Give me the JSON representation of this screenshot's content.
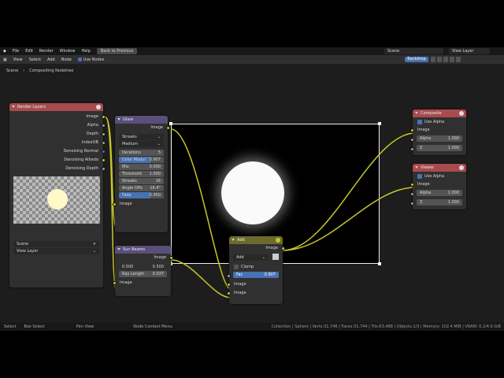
{
  "menubar": {
    "items": [
      "File",
      "Edit",
      "Render",
      "Window",
      "Help"
    ],
    "back_button": "Back to Previous",
    "scene": "Scene",
    "view_layer": "View Layer"
  },
  "header": {
    "items": [
      "View",
      "Select",
      "Add",
      "Node"
    ],
    "use_nodes": "Use Nodes",
    "backdrop": "Backdrop"
  },
  "breadcrumb": [
    "Scene",
    "Compositing Nodetree"
  ],
  "nodes": {
    "render_layers": {
      "title": "Render Layers",
      "outputs": [
        "Image",
        "Alpha",
        "Depth",
        "IndexOB",
        "Denoising Normal",
        "Denoising Albedo",
        "Denoising Depth"
      ],
      "scene": "Scene",
      "view_layer": "View Layer"
    },
    "glare": {
      "title": "Glare",
      "output": "Image",
      "type": "Streaks",
      "quality": "Medium",
      "iterations_label": "Iterations",
      "iterations": "5",
      "color_mod_label": "Color Modul",
      "color_mod": "0.907",
      "mix_label": "Mix",
      "mix": "0.000",
      "threshold_label": "Threshold",
      "threshold": "1.000",
      "streaks_label": "Streaks",
      "streaks": "16",
      "angle_label": "Angle Offs",
      "angle": "16.4°",
      "fade_label": "Fade",
      "fade": "0.950",
      "input": "Image"
    },
    "sun_beams": {
      "title": "Sun Beams",
      "output": "Image",
      "source_x": "0.500",
      "source_y": "0.500",
      "ray_length_label": "Ray Length",
      "ray_length": "0.037",
      "input": "Image"
    },
    "add": {
      "title": "Add",
      "output": "Image",
      "blend": "Add",
      "clamp": "Clamp",
      "fac_label": "Fac",
      "fac": "0.907",
      "input1": "Image",
      "input2": "Image"
    },
    "composite": {
      "title": "Composite",
      "use_alpha": "Use Alpha",
      "image": "Image",
      "alpha_label": "Alpha",
      "alpha": "1.000",
      "z_label": "Z",
      "z": "1.000"
    },
    "viewer": {
      "title": "Viewer",
      "use_alpha": "Use Alpha",
      "image": "Image",
      "alpha_label": "Alpha",
      "alpha": "1.000",
      "z_label": "Z",
      "z": "1.000"
    }
  },
  "status": {
    "select": "Select",
    "box_select": "Box Select",
    "pan_view": "Pan View",
    "context_menu": "Node Context Menu",
    "stats": "Collection | Sphere | Verts:31,746 | Faces:31,744 | Tris:63,488 | Objects:1/3 | Memory: 102.4 MiB | VRAM: 0.2/4.0 GiB"
  },
  "colors": {
    "input_node": "#a84b4f",
    "filter_node": "#5a4f7a",
    "color_node": "#6b6b2e",
    "output_node": "#a84b4f",
    "socket_image": "#c7c729",
    "socket_value": "#a1a1a1",
    "accent": "#4772b3"
  }
}
